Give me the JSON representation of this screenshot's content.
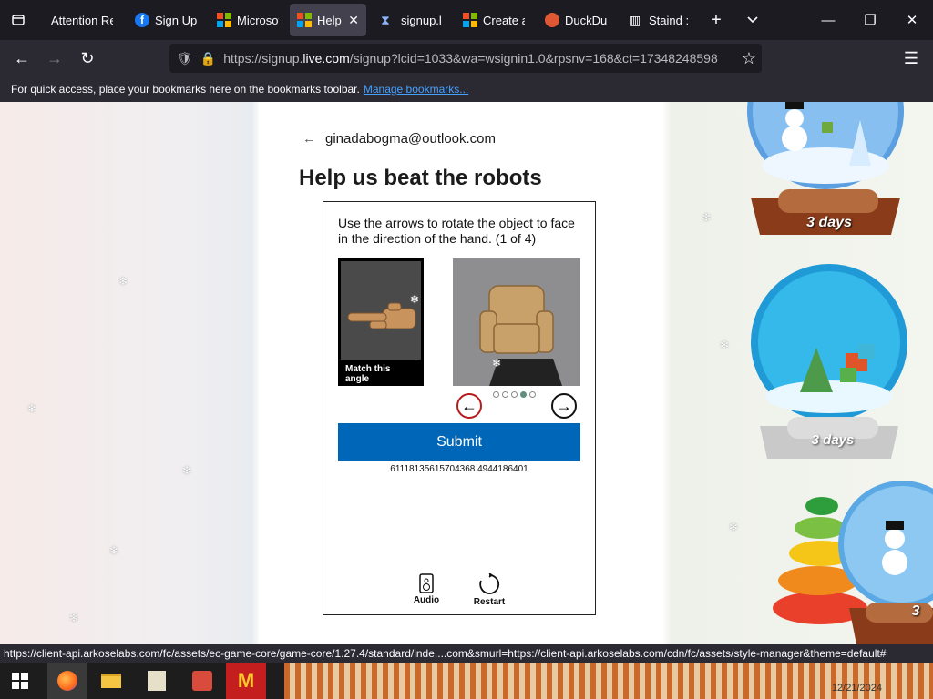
{
  "browser": {
    "tabs": [
      {
        "label": "Attention Re",
        "icon": "none"
      },
      {
        "label": "Sign Up",
        "icon": "facebook-icon"
      },
      {
        "label": "Microsof",
        "icon": "microsoft-icon"
      },
      {
        "label": "Help",
        "icon": "microsoft-icon",
        "active": true
      },
      {
        "label": "signup.l",
        "icon": "hourglass-icon"
      },
      {
        "label": "Create a",
        "icon": "microsoft-icon"
      },
      {
        "label": "DuckDu",
        "icon": "duckduckgo-icon"
      },
      {
        "label": "Staind :",
        "icon": "library-icon"
      }
    ],
    "url_prefix": "https://signup.",
    "url_domain": "live.com",
    "url_rest": "/signup?lcid=1033&wa=wsignin1.0&rpsnv=168&ct=17348248598",
    "bookmarks_text": "For quick access, place your bookmarks here on the bookmarks toolbar.",
    "bookmarks_link": "Manage bookmarks..."
  },
  "page": {
    "email": "ginadabogma@outlook.com",
    "title": "Help us beat the robots",
    "instructions": "Use the arrows to rotate the object to face in the direction of the hand. (1 of 4)",
    "match_label": "Match this angle",
    "submit_label": "Submit",
    "token": "61118135615704368.4944186401",
    "audio_label": "Audio",
    "restart_label": "Restart",
    "current_dot": 4,
    "dot_count": 5
  },
  "decorations": {
    "globe_label_1": "3 days",
    "globe_label_2": "3 days",
    "globe_label_3": "3"
  },
  "status_url": "https://client-api.arkoselabs.com/fc/assets/ec-game-core/game-core/1.27.4/standard/inde....com&smurl=https://client-api.arkoselabs.com/cdn/fc/assets/style-manager&theme=default#",
  "taskbar": {
    "clock": "12/21/2024"
  },
  "colors": {
    "accent": "#0067b8",
    "tabbar": "#1c1b22",
    "toolbar": "#2b2a33"
  }
}
